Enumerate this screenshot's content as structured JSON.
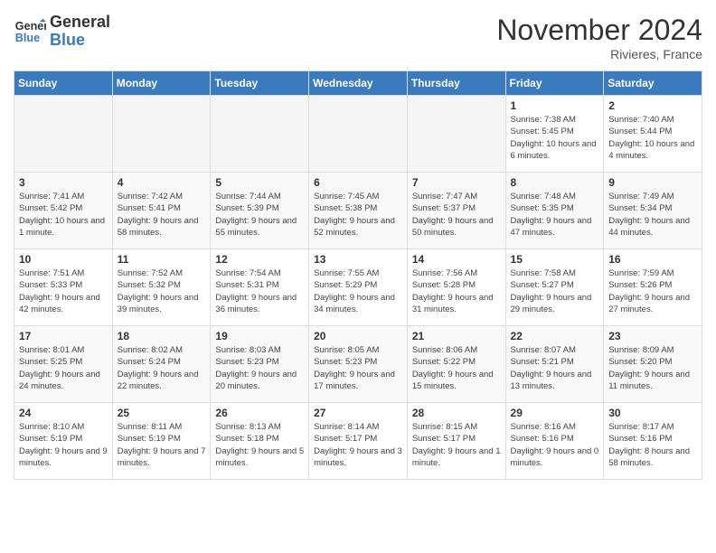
{
  "header": {
    "logo_line1": "General",
    "logo_line2": "Blue",
    "month_title": "November 2024",
    "location": "Rivieres, France"
  },
  "days_of_week": [
    "Sunday",
    "Monday",
    "Tuesday",
    "Wednesday",
    "Thursday",
    "Friday",
    "Saturday"
  ],
  "weeks": [
    [
      {
        "day": "",
        "empty": true
      },
      {
        "day": "",
        "empty": true
      },
      {
        "day": "",
        "empty": true
      },
      {
        "day": "",
        "empty": true
      },
      {
        "day": "",
        "empty": true
      },
      {
        "day": "1",
        "sunrise": "Sunrise: 7:38 AM",
        "sunset": "Sunset: 5:45 PM",
        "daylight": "Daylight: 10 hours and 6 minutes."
      },
      {
        "day": "2",
        "sunrise": "Sunrise: 7:40 AM",
        "sunset": "Sunset: 5:44 PM",
        "daylight": "Daylight: 10 hours and 4 minutes."
      }
    ],
    [
      {
        "day": "3",
        "sunrise": "Sunrise: 7:41 AM",
        "sunset": "Sunset: 5:42 PM",
        "daylight": "Daylight: 10 hours and 1 minute."
      },
      {
        "day": "4",
        "sunrise": "Sunrise: 7:42 AM",
        "sunset": "Sunset: 5:41 PM",
        "daylight": "Daylight: 9 hours and 58 minutes."
      },
      {
        "day": "5",
        "sunrise": "Sunrise: 7:44 AM",
        "sunset": "Sunset: 5:39 PM",
        "daylight": "Daylight: 9 hours and 55 minutes."
      },
      {
        "day": "6",
        "sunrise": "Sunrise: 7:45 AM",
        "sunset": "Sunset: 5:38 PM",
        "daylight": "Daylight: 9 hours and 52 minutes."
      },
      {
        "day": "7",
        "sunrise": "Sunrise: 7:47 AM",
        "sunset": "Sunset: 5:37 PM",
        "daylight": "Daylight: 9 hours and 50 minutes."
      },
      {
        "day": "8",
        "sunrise": "Sunrise: 7:48 AM",
        "sunset": "Sunset: 5:35 PM",
        "daylight": "Daylight: 9 hours and 47 minutes."
      },
      {
        "day": "9",
        "sunrise": "Sunrise: 7:49 AM",
        "sunset": "Sunset: 5:34 PM",
        "daylight": "Daylight: 9 hours and 44 minutes."
      }
    ],
    [
      {
        "day": "10",
        "sunrise": "Sunrise: 7:51 AM",
        "sunset": "Sunset: 5:33 PM",
        "daylight": "Daylight: 9 hours and 42 minutes."
      },
      {
        "day": "11",
        "sunrise": "Sunrise: 7:52 AM",
        "sunset": "Sunset: 5:32 PM",
        "daylight": "Daylight: 9 hours and 39 minutes."
      },
      {
        "day": "12",
        "sunrise": "Sunrise: 7:54 AM",
        "sunset": "Sunset: 5:31 PM",
        "daylight": "Daylight: 9 hours and 36 minutes."
      },
      {
        "day": "13",
        "sunrise": "Sunrise: 7:55 AM",
        "sunset": "Sunset: 5:29 PM",
        "daylight": "Daylight: 9 hours and 34 minutes."
      },
      {
        "day": "14",
        "sunrise": "Sunrise: 7:56 AM",
        "sunset": "Sunset: 5:28 PM",
        "daylight": "Daylight: 9 hours and 31 minutes."
      },
      {
        "day": "15",
        "sunrise": "Sunrise: 7:58 AM",
        "sunset": "Sunset: 5:27 PM",
        "daylight": "Daylight: 9 hours and 29 minutes."
      },
      {
        "day": "16",
        "sunrise": "Sunrise: 7:59 AM",
        "sunset": "Sunset: 5:26 PM",
        "daylight": "Daylight: 9 hours and 27 minutes."
      }
    ],
    [
      {
        "day": "17",
        "sunrise": "Sunrise: 8:01 AM",
        "sunset": "Sunset: 5:25 PM",
        "daylight": "Daylight: 9 hours and 24 minutes."
      },
      {
        "day": "18",
        "sunrise": "Sunrise: 8:02 AM",
        "sunset": "Sunset: 5:24 PM",
        "daylight": "Daylight: 9 hours and 22 minutes."
      },
      {
        "day": "19",
        "sunrise": "Sunrise: 8:03 AM",
        "sunset": "Sunset: 5:23 PM",
        "daylight": "Daylight: 9 hours and 20 minutes."
      },
      {
        "day": "20",
        "sunrise": "Sunrise: 8:05 AM",
        "sunset": "Sunset: 5:23 PM",
        "daylight": "Daylight: 9 hours and 17 minutes."
      },
      {
        "day": "21",
        "sunrise": "Sunrise: 8:06 AM",
        "sunset": "Sunset: 5:22 PM",
        "daylight": "Daylight: 9 hours and 15 minutes."
      },
      {
        "day": "22",
        "sunrise": "Sunrise: 8:07 AM",
        "sunset": "Sunset: 5:21 PM",
        "daylight": "Daylight: 9 hours and 13 minutes."
      },
      {
        "day": "23",
        "sunrise": "Sunrise: 8:09 AM",
        "sunset": "Sunset: 5:20 PM",
        "daylight": "Daylight: 9 hours and 11 minutes."
      }
    ],
    [
      {
        "day": "24",
        "sunrise": "Sunrise: 8:10 AM",
        "sunset": "Sunset: 5:19 PM",
        "daylight": "Daylight: 9 hours and 9 minutes."
      },
      {
        "day": "25",
        "sunrise": "Sunrise: 8:11 AM",
        "sunset": "Sunset: 5:19 PM",
        "daylight": "Daylight: 9 hours and 7 minutes."
      },
      {
        "day": "26",
        "sunrise": "Sunrise: 8:13 AM",
        "sunset": "Sunset: 5:18 PM",
        "daylight": "Daylight: 9 hours and 5 minutes."
      },
      {
        "day": "27",
        "sunrise": "Sunrise: 8:14 AM",
        "sunset": "Sunset: 5:17 PM",
        "daylight": "Daylight: 9 hours and 3 minutes."
      },
      {
        "day": "28",
        "sunrise": "Sunrise: 8:15 AM",
        "sunset": "Sunset: 5:17 PM",
        "daylight": "Daylight: 9 hours and 1 minute."
      },
      {
        "day": "29",
        "sunrise": "Sunrise: 8:16 AM",
        "sunset": "Sunset: 5:16 PM",
        "daylight": "Daylight: 9 hours and 0 minutes."
      },
      {
        "day": "30",
        "sunrise": "Sunrise: 8:17 AM",
        "sunset": "Sunset: 5:16 PM",
        "daylight": "Daylight: 8 hours and 58 minutes."
      }
    ]
  ]
}
